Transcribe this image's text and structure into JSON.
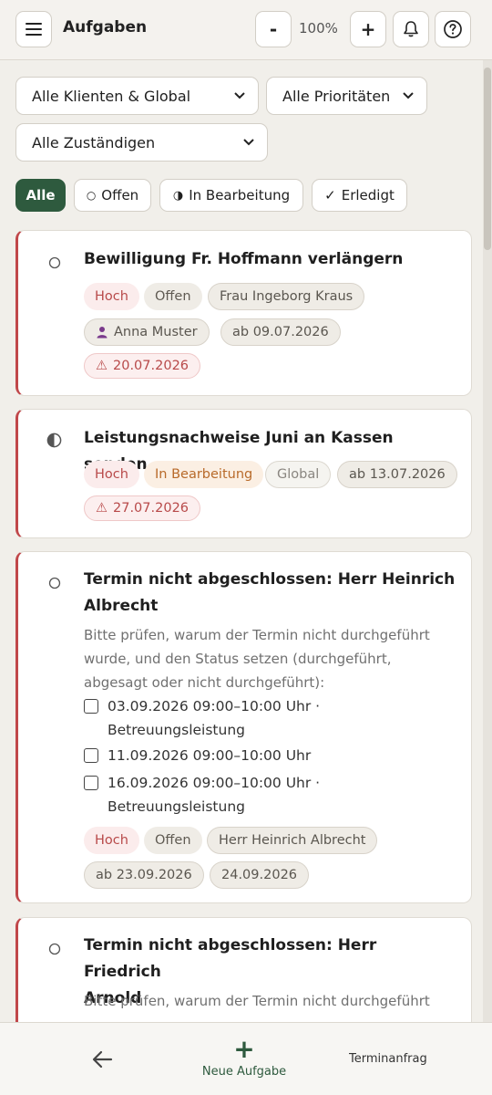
{
  "header": {
    "title": "Aufgaben",
    "zoom": "100%",
    "zoom_out": "-",
    "zoom_in": "+"
  },
  "filters": {
    "client": "Alle Klienten & Global",
    "priority": "Alle Prioritäten",
    "assignee": "Alle Zuständigen"
  },
  "status_tabs": [
    {
      "label": "Alle",
      "icon": ""
    },
    {
      "label": "Offen",
      "icon": "○"
    },
    {
      "label": "In Bearbeitung",
      "icon": "◑"
    },
    {
      "label": "Erledigt",
      "icon": "✓"
    }
  ],
  "tasks": [
    {
      "title": "Bewilligung Fr. Hoffmann verlängern",
      "priority": "Hoch",
      "status": "Offen",
      "client": "Frau Ingeborg Kraus",
      "assignee": "Anna Muster",
      "start": "ab 09.07.2026",
      "due": "20.07.2026"
    },
    {
      "title": "Leistungsnachweise Juni an Kassen senden",
      "priority": "Hoch",
      "status": "In Bearbeitung",
      "client": "Global",
      "start": "ab 13.07.2026",
      "due": "27.07.2026"
    },
    {
      "title_line1": "Termin nicht abgeschlossen: Herr Heinrich",
      "title_line2": "Albrecht",
      "desc_line1": "Bitte prüfen, warum der Termin nicht durchgeführt",
      "desc_line2": "wurde, und den Status setzen (durchgeführt,",
      "desc_line3": "abgesagt oder nicht durchgeführt):",
      "checklist": [
        {
          "line1": "03.09.2026 09:00–10:00 Uhr ·",
          "line2": "Betreuungsleistung"
        },
        {
          "line1": "11.09.2026 09:00–10:00 Uhr",
          "line2": ""
        },
        {
          "line1": "16.09.2026 09:00–10:00 Uhr ·",
          "line2": "Betreuungsleistung"
        }
      ],
      "priority": "Hoch",
      "status": "Offen",
      "client": "Herr Heinrich Albrecht",
      "start": "ab 23.09.2026",
      "due": "24.09.2026"
    },
    {
      "title_line1": "Termin nicht abgeschlossen: Herr Friedrich",
      "title_line2": "Arnold",
      "desc_line1": "Bitte prüfen, warum der Termin nicht durchgeführt"
    }
  ],
  "bottom_nav": {
    "new_label": "Neue Aufgabe",
    "requests_label": "Terminanfragen"
  },
  "colors": {
    "accent_green": "#2e5a3e",
    "priority_red": "#c0474a",
    "in_progress_orange": "#b86a2a"
  }
}
